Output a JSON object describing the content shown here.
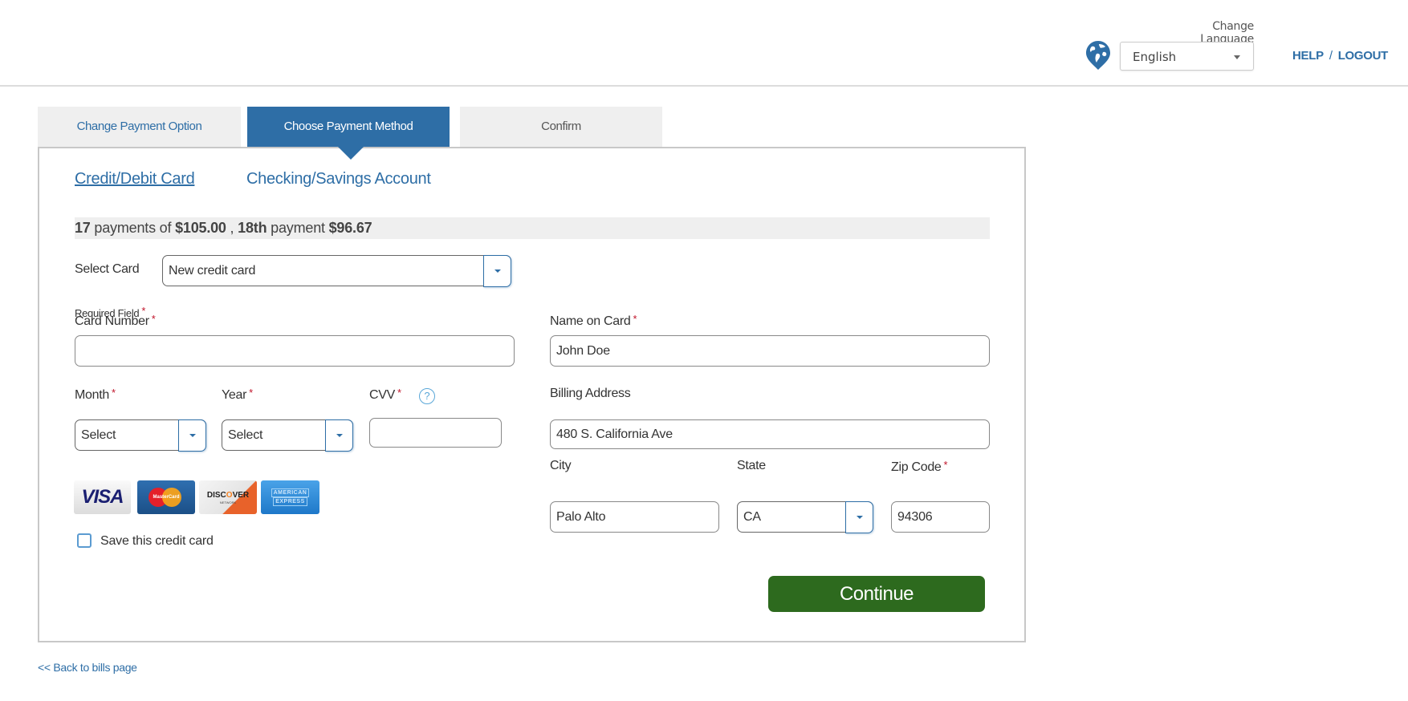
{
  "header": {
    "change_language_label": "Change Language",
    "language_selected": "English",
    "help_label": "HELP",
    "separator": "/",
    "logout_label": "LOGOUT",
    "globe_icon": "globe-pin-icon"
  },
  "tabs": [
    {
      "label": "Change Payment Option",
      "active": false
    },
    {
      "label": "Choose Payment Method",
      "active": true
    },
    {
      "label": "Confirm",
      "active": false
    }
  ],
  "payment_methods": {
    "credit": "Credit/Debit Card",
    "checking": "Checking/Savings Account",
    "selected": "Credit/Debit Card"
  },
  "plan": {
    "count": "17",
    "text1": " payments of ",
    "amount": "$105.00",
    "text2": " , ",
    "final_ordinal": "18th",
    "text3": " payment ",
    "final_amount": "$96.67"
  },
  "form": {
    "select_card_label": "Select Card",
    "select_card_value": "New credit card",
    "required_note": "Required Field",
    "required_mark": "*",
    "card_number_label": "Card Number",
    "card_number_value": "",
    "name_on_card_label": "Name on Card",
    "name_on_card_value": "John Doe",
    "month_label": "Month",
    "month_value": "Select",
    "year_label": "Year",
    "year_value": "Select",
    "cvv_label": "CVV",
    "cvv_value": "",
    "cvv_help": "?",
    "billing_address_label": "Billing Address",
    "billing_address_value": "480 S. California Ave",
    "city_label": "City",
    "city_value": "Palo Alto",
    "state_label": "State",
    "state_value": "CA",
    "zip_label": "Zip Code",
    "zip_value": "94306",
    "save_card_label": "Save this credit card",
    "save_card_checked": false
  },
  "card_logos": {
    "visa": "VISA",
    "mastercard": "MasterCard",
    "discover_a": "DISC",
    "discover_o": "O",
    "discover_b": "VER",
    "discover_net": "NETWORK",
    "amex_1": "AMERICAN",
    "amex_2": "EXPRESS"
  },
  "actions": {
    "continue_label": "Continue",
    "back_label": "<< Back to bills page"
  },
  "colors": {
    "brand_blue": "#2e6ea6",
    "continue_green": "#2d6a1e",
    "required_red": "#c0142a",
    "tab_gray": "#efefef"
  }
}
